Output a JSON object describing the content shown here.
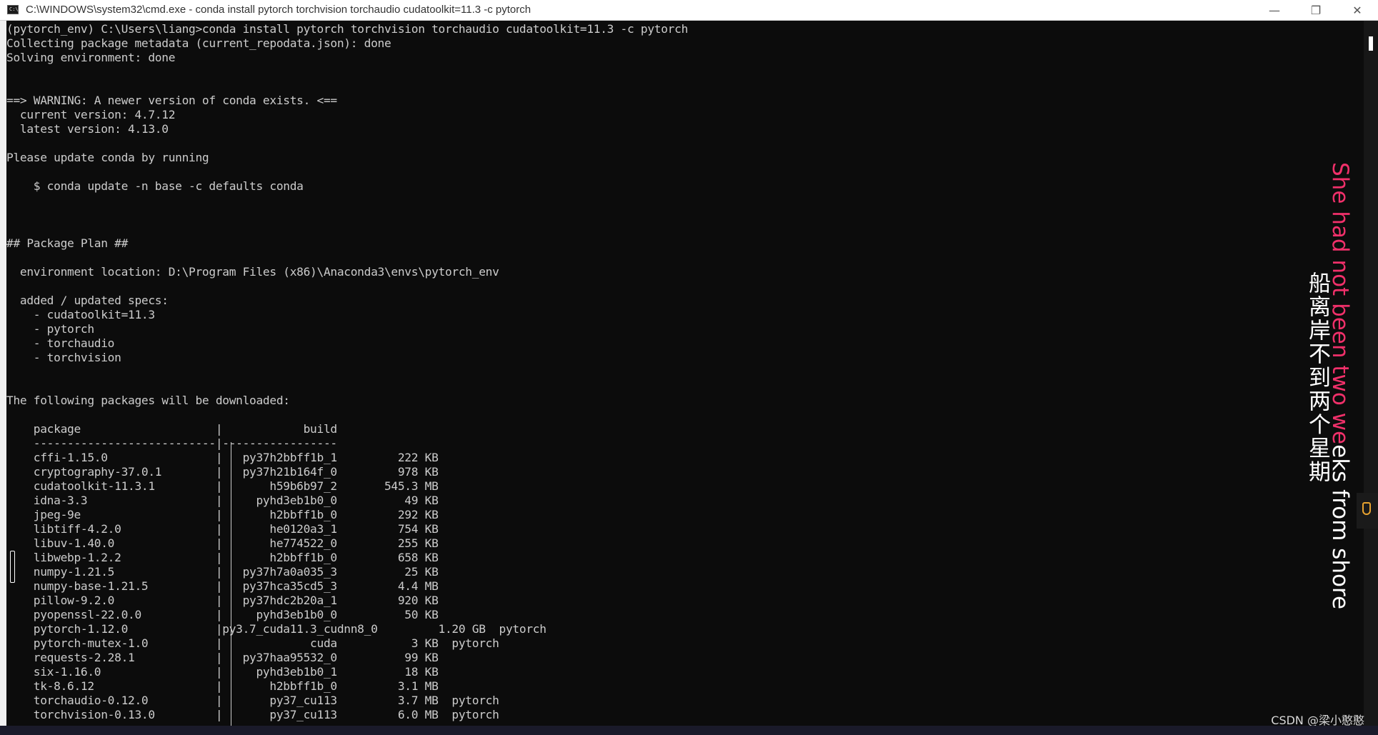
{
  "window": {
    "title": "C:\\WINDOWS\\system32\\cmd.exe - conda  install pytorch torchvision torchaudio cudatoolkit=11.3 -c pytorch",
    "icon_text": "C:\\",
    "buttons": [
      "minimize-icon",
      "restore-icon",
      "close-icon"
    ]
  },
  "terminal": {
    "lines": [
      "(pytorch_env) C:\\Users\\liang>conda install pytorch torchvision torchaudio cudatoolkit=11.3 -c pytorch",
      "Collecting package metadata (current_repodata.json): done",
      "Solving environment: done",
      "",
      "",
      "==> WARNING: A newer version of conda exists. <==",
      "  current version: 4.7.12",
      "  latest version: 4.13.0",
      "",
      "Please update conda by running",
      "",
      "    $ conda update -n base -c defaults conda",
      "",
      "",
      "",
      "## Package Plan ##",
      "",
      "  environment location: D:\\Program Files (x86)\\Anaconda3\\envs\\pytorch_env",
      "",
      "  added / updated specs:",
      "    - cudatoolkit=11.3",
      "    - pytorch",
      "    - torchaudio",
      "    - torchvision",
      "",
      "",
      "The following packages will be downloaded:",
      "",
      "    package                    |            build",
      "    ---------------------------|-----------------",
      "    cffi-1.15.0                |   py37h2bbff1b_1         222 KB",
      "    cryptography-37.0.1        |   py37h21b164f_0         978 KB",
      "    cudatoolkit-11.3.1         |       h59b6b97_2       545.3 MB",
      "    idna-3.3                   |     pyhd3eb1b0_0          49 KB",
      "    jpeg-9e                    |       h2bbff1b_0         292 KB",
      "    libtiff-4.2.0              |       he0120a3_1         754 KB",
      "    libuv-1.40.0               |       he774522_0         255 KB",
      "    libwebp-1.2.2              |       h2bbff1b_0         658 KB",
      "    numpy-1.21.5               |   py37h7a0a035_3          25 KB",
      "    numpy-base-1.21.5          |   py37hca35cd5_3         4.4 MB",
      "    pillow-9.2.0               |   py37hdc2b20a_1         920 KB",
      "    pyopenssl-22.0.0           |     pyhd3eb1b0_0          50 KB",
      "    pytorch-1.12.0             |py3.7_cuda11.3_cudnn8_0         1.20 GB  pytorch",
      "    pytorch-mutex-1.0          |             cuda           3 KB  pytorch",
      "    requests-2.28.1            |   py37haa95532_0          99 KB",
      "    six-1.16.0                 |     pyhd3eb1b0_1          18 KB",
      "    tk-8.6.12                  |       h2bbff1b_0         3.1 MB",
      "    torchaudio-0.12.0          |       py37_cu113         3.7 MB  pytorch",
      "    torchvision-0.13.0         |       py37_cu113         6.0 MB  pytorch"
    ]
  },
  "overlay": {
    "english_pink": "She had not been two we",
    "english_white": "eks from shore",
    "chinese": "船离岸不到两个星期"
  },
  "watermark": "CSDN @梁小憨憨",
  "colors": {
    "terminal_bg": "#0c0c0c",
    "terminal_fg": "#cccccc",
    "accent_pink": "#f0306a"
  }
}
